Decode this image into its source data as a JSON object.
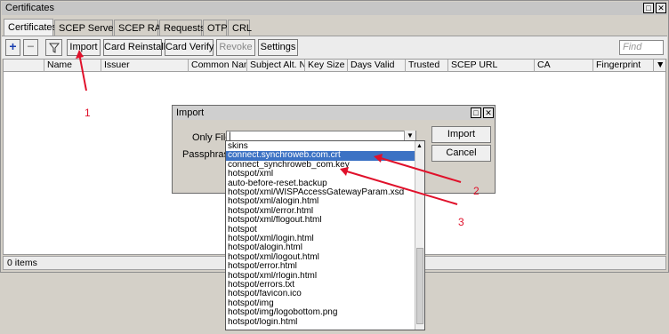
{
  "window": {
    "title": "Certificates"
  },
  "tabs": [
    "Certificates",
    "SCEP Servers",
    "SCEP RA",
    "Requests",
    "OTP",
    "CRL"
  ],
  "toolbar": {
    "import": "Import",
    "card_reinstall": "Card Reinstall",
    "card_verify": "Card Verify",
    "revoke": "Revoke",
    "settings": "Settings",
    "find_placeholder": "Find"
  },
  "columns": [
    "Name",
    "Issuer",
    "Common Name",
    "Subject Alt. N...",
    "Key Size",
    "Days Valid",
    "Trusted",
    "SCEP URL",
    "CA",
    "Fingerprint"
  ],
  "status": "0 items",
  "dialog": {
    "title": "Import",
    "only_file_label": "Only File:",
    "passphrase_label": "Passphrase:",
    "import_button": "Import",
    "cancel_button": "Cancel",
    "file_options": [
      "skins",
      "connect.synchroweb.com.crt",
      "connect_synchroweb_com.key",
      "hotspot/xml",
      "auto-before-reset.backup",
      "hotspot/xml/WISPAccessGatewayParam.xsd",
      "hotspot/xml/alogin.html",
      "hotspot/xml/error.html",
      "hotspot/xml/flogout.html",
      "hotspot",
      "hotspot/xml/login.html",
      "hotspot/alogin.html",
      "hotspot/xml/logout.html",
      "hotspot/error.html",
      "hotspot/xml/rlogin.html",
      "hotspot/errors.txt",
      "hotspot/favicon.ico",
      "hotspot/img",
      "hotspot/img/logobottom.png",
      "hotspot/login.html"
    ],
    "selected_index": 1
  },
  "annotations": [
    "1",
    "2",
    "3"
  ],
  "colors": {
    "annotation": "#e0102a",
    "selection": "#3c72c4"
  }
}
